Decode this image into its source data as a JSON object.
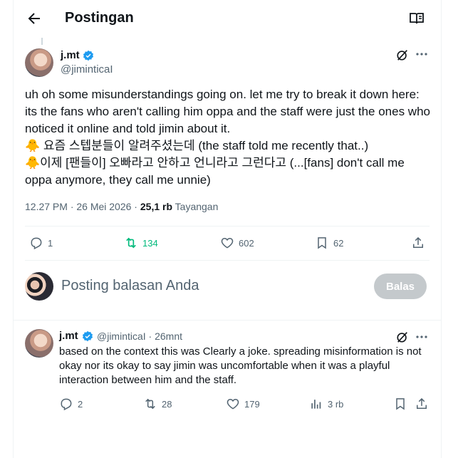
{
  "header": {
    "title": "Postingan"
  },
  "post": {
    "author_name": "j.mt",
    "author_handle": "@jiminticaI",
    "text": "uh oh some misunderstandings going on. let me try to break it down here: its the fans who aren't calling him oppa and the staff were just the ones who noticed it online and told jimin about it.\n🐥 요즘 스텝분들이 알려주셨는데 (the staff told me recently that..)\n🐥이제 [팬들이] 오빠라고 안하고 언니라고 그런다고 (...[fans] don't call me oppa anymore, they call me unnie)",
    "time": "12.27 PM · 26 Mei 2026 · ",
    "views_count": "25,1 rb",
    "views_label": " Tayangan",
    "replies": "1",
    "reposts": "134",
    "likes": "602",
    "bookmarks": "62"
  },
  "reply_box": {
    "placeholder": "Posting balasan Anda",
    "button": "Balas"
  },
  "reply": {
    "author_name": "j.mt",
    "author_handle": "@jiminticaI · 26mnt",
    "text": "based on the context this was Clearly a joke. spreading misinformation is not okay nor its okay to say jimin was uncomfortable when it was a playful interaction between him and the staff.",
    "replies": "2",
    "reposts": "28",
    "likes": "179",
    "views": "3 rb"
  },
  "colors": {
    "verified": "#1d9bf0",
    "repost_active": "#00ba7c",
    "text_secondary": "#536471"
  }
}
